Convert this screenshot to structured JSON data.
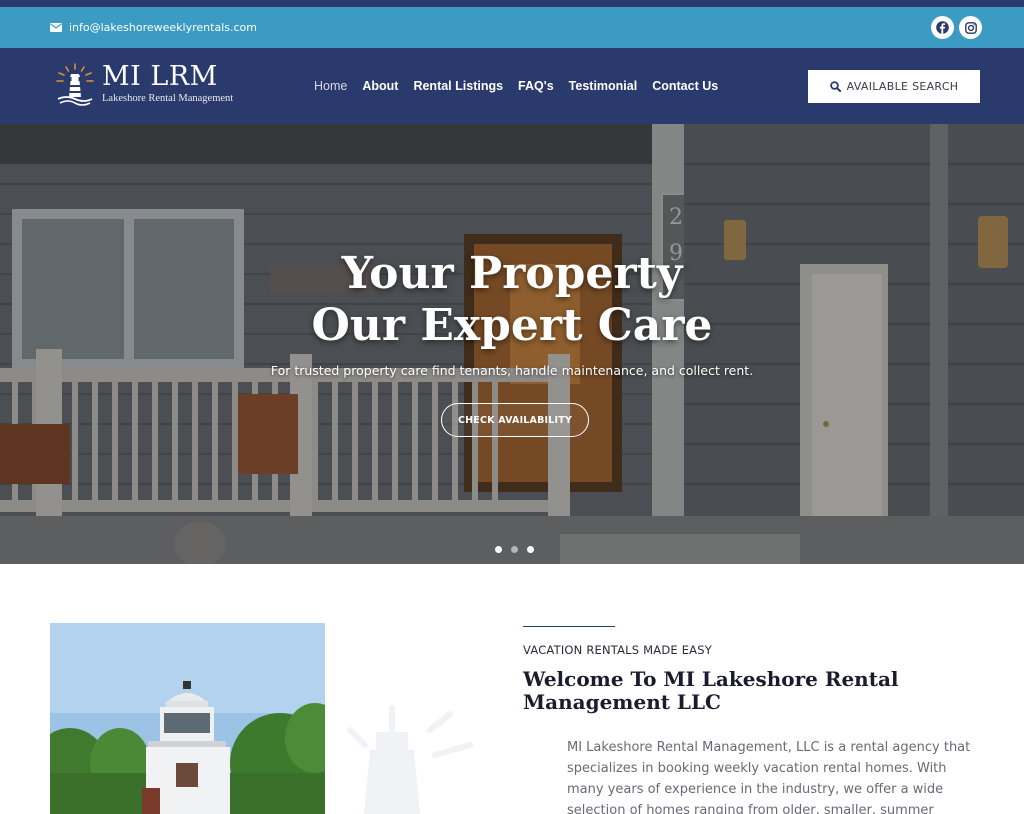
{
  "contact": {
    "email": "info@lakeshoreweeklyrentals.com",
    "email_icon": "envelope-icon",
    "social": [
      {
        "name": "facebook",
        "icon": "facebook-icon"
      },
      {
        "name": "instagram",
        "icon": "instagram-icon"
      }
    ]
  },
  "brand": {
    "title": "MI LRM",
    "subtitle": "Lakeshore Rental Management",
    "logo_icon": "lighthouse-icon"
  },
  "nav": {
    "items": [
      {
        "label": "Home",
        "active": true
      },
      {
        "label": "About"
      },
      {
        "label": "Rental Listings"
      },
      {
        "label": "FAQ's"
      },
      {
        "label": "Testimonial"
      },
      {
        "label": "Contact Us"
      }
    ],
    "search_button": "AVAILABLE SEARCH",
    "search_icon": "search-icon"
  },
  "hero": {
    "title_line1": "Your Property",
    "title_line2": "Our Expert Care",
    "subtitle": "For trusted property care find tenants, handle maintenance, and collect rent.",
    "button": "CHECK AVAILABILITY",
    "slides": 3,
    "active_slide": 1,
    "house_number": "29"
  },
  "about": {
    "eyebrow": "VACATION RENTALS MADE EASY",
    "heading": "Welcome To MI Lakeshore Rental Management LLC",
    "body": "MI Lakeshore Rental Management, LLC is a rental agency that specializes in booking weekly vacation rental homes. With many years of experience in the industry, we offer a wide selection of homes ranging from older, smaller, summer"
  },
  "colors": {
    "navy": "#2a3a6c",
    "sky": "#3b9bc3",
    "white": "#ffffff"
  }
}
